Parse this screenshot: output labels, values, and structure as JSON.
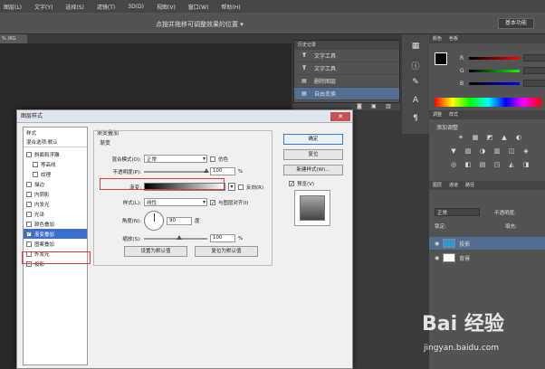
{
  "menu": [
    "图层(L)",
    "文字(Y)",
    "选择(S)",
    "滤镜(T)",
    "3D(D)",
    "视图(V)",
    "窗口(W)",
    "帮助(H)"
  ],
  "options_hint": "点按并拖移可调整效果的位置 ▾",
  "workspace_button": "基本功能",
  "doc_tab": "% (RG",
  "history": {
    "tabs": [
      "历史记录"
    ],
    "items": [
      {
        "icon": "T",
        "label": "文字工具"
      },
      {
        "icon": "T",
        "label": "文字工具"
      },
      {
        "icon": "▤",
        "label": "删除图层"
      },
      {
        "icon": "▤",
        "label": "自由变换"
      }
    ]
  },
  "color_panel": {
    "tabs": [
      "颜色",
      "色板"
    ],
    "channels": [
      "R",
      "G",
      "B"
    ]
  },
  "adjust_panel": {
    "tabs": [
      "调整",
      "样式"
    ],
    "title": "添加调整"
  },
  "layers_panel": {
    "tabs": [
      "图层",
      "通道",
      "路径"
    ],
    "blend": "正常",
    "opacity_label": "不透明度:",
    "lock_label": "锁定:",
    "fill_label": "填充:",
    "layers": [
      {
        "name": "投影",
        "selected": true
      },
      {
        "name": "背景",
        "selected": false
      }
    ]
  },
  "dialog": {
    "title": "图层样式",
    "close": "✕",
    "styles": [
      {
        "label": "样式",
        "type": "head"
      },
      {
        "label": "混合选项:默认",
        "type": "head"
      },
      {
        "label": "斜面和浮雕",
        "type": "cb"
      },
      {
        "label": "等高线",
        "type": "sub"
      },
      {
        "label": "纹理",
        "type": "sub"
      },
      {
        "label": "描边",
        "type": "cb"
      },
      {
        "label": "内阴影",
        "type": "cb"
      },
      {
        "label": "内发光",
        "type": "cb"
      },
      {
        "label": "光泽",
        "type": "cb"
      },
      {
        "label": "颜色叠加",
        "type": "cb"
      },
      {
        "label": "渐变叠加",
        "type": "cb",
        "selected": true
      },
      {
        "label": "图案叠加",
        "type": "cb"
      },
      {
        "label": "外发光",
        "type": "cb"
      },
      {
        "label": "投影",
        "type": "cb"
      }
    ],
    "section_title": "渐变叠加",
    "group_title": "渐变",
    "blend_label": "混合模式(O):",
    "blend_value": "正常",
    "dither_label": "仿色",
    "opacity_label": "不透明度(P):",
    "opacity_value": "100",
    "percent": "%",
    "gradient_label": "渐变:",
    "reverse_label": "反向(R)",
    "style_label": "样式(L):",
    "style_value": "线性",
    "align_label": "与图层对齐(I)",
    "angle_label": "角度(N):",
    "angle_value": "90",
    "degree": "度",
    "scale_label": "缩放(S):",
    "scale_value": "100",
    "set_default": "设置为默认值",
    "reset_default": "复位为默认值",
    "ok": "确定",
    "reset": "复位",
    "new_style": "新建样式(W)...",
    "preview_label": "预览(V)"
  },
  "watermark": {
    "logo": "Bai 经验",
    "url": "jingyan.baidu.com"
  }
}
